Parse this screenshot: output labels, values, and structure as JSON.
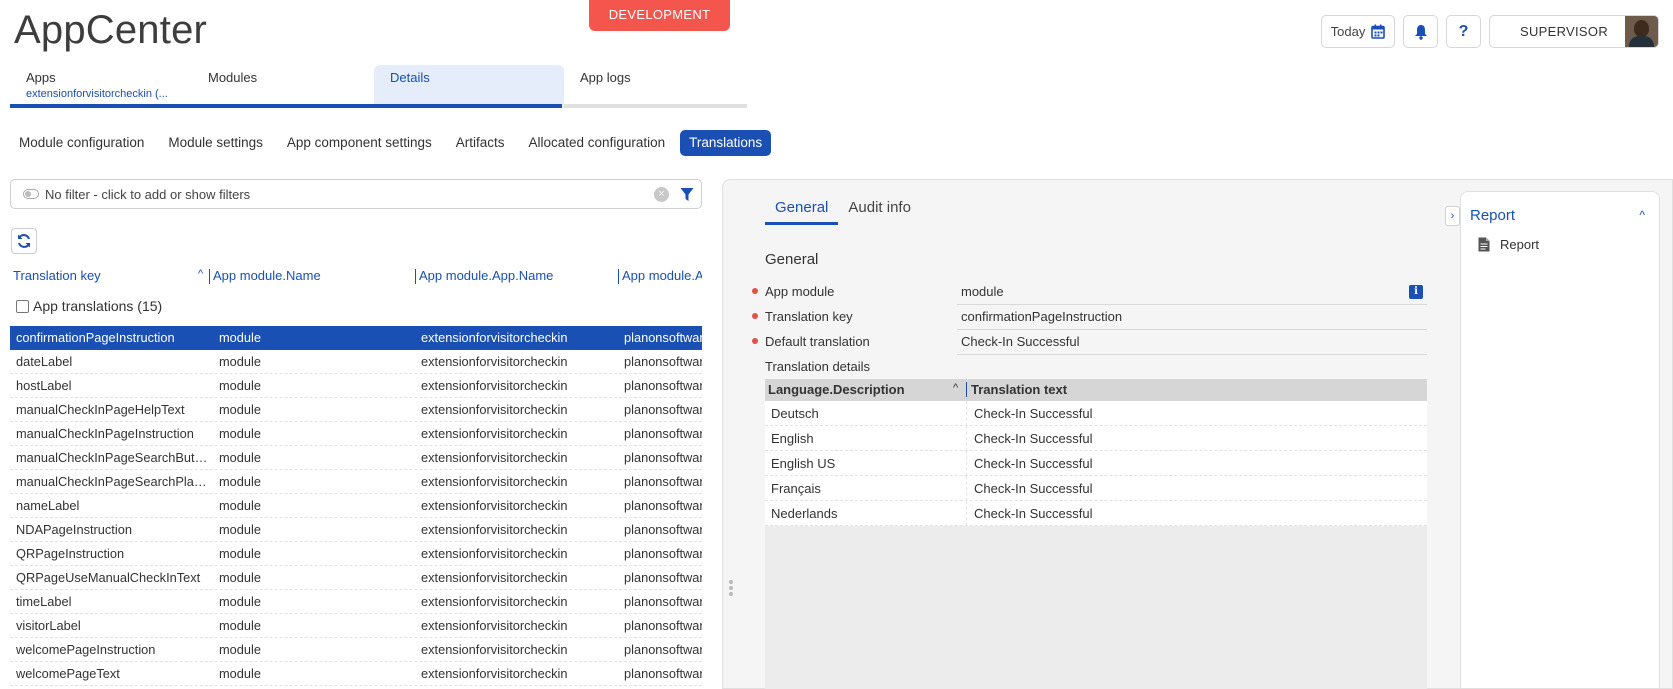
{
  "app": {
    "title": "AppCenter",
    "environment": "DEVELOPMENT"
  },
  "header": {
    "today_label": "Today",
    "help_label": "?",
    "user_name": "SUPERVISOR"
  },
  "main_tabs": [
    {
      "label": "Apps",
      "sub": "extensionforvisitorcheckin (..."
    },
    {
      "label": "Modules"
    },
    {
      "label": "Details"
    },
    {
      "label": "App logs"
    }
  ],
  "sub_tabs": [
    "Module configuration",
    "Module settings",
    "App component settings",
    "Artifacts",
    "Allocated configuration",
    "Translations"
  ],
  "filter": {
    "text": "No filter - click to add or show filters"
  },
  "grid": {
    "columns": [
      "Translation key",
      "App module.Name",
      "App module.App.Name",
      "App module.Ap"
    ],
    "group_label": "App translations (15)",
    "rows": [
      [
        "confirmationPageInstruction",
        "module",
        "extensionforvisitorcheckin",
        "planonsoftwar"
      ],
      [
        "dateLabel",
        "module",
        "extensionforvisitorcheckin",
        "planonsoftwar"
      ],
      [
        "hostLabel",
        "module",
        "extensionforvisitorcheckin",
        "planonsoftwar"
      ],
      [
        "manualCheckInPageHelpText",
        "module",
        "extensionforvisitorcheckin",
        "planonsoftwar"
      ],
      [
        "manualCheckInPageInstruction",
        "module",
        "extensionforvisitorcheckin",
        "planonsoftwar"
      ],
      [
        "manualCheckInPageSearchButto...",
        "module",
        "extensionforvisitorcheckin",
        "planonsoftwar"
      ],
      [
        "manualCheckInPageSearchPlace...",
        "module",
        "extensionforvisitorcheckin",
        "planonsoftwar"
      ],
      [
        "nameLabel",
        "module",
        "extensionforvisitorcheckin",
        "planonsoftwar"
      ],
      [
        "NDAPageInstruction",
        "module",
        "extensionforvisitorcheckin",
        "planonsoftwar"
      ],
      [
        "QRPageInstruction",
        "module",
        "extensionforvisitorcheckin",
        "planonsoftwar"
      ],
      [
        "QRPageUseManualCheckInText",
        "module",
        "extensionforvisitorcheckin",
        "planonsoftwar"
      ],
      [
        "timeLabel",
        "module",
        "extensionforvisitorcheckin",
        "planonsoftwar"
      ],
      [
        "visitorLabel",
        "module",
        "extensionforvisitorcheckin",
        "planonsoftwar"
      ],
      [
        "welcomePageInstruction",
        "module",
        "extensionforvisitorcheckin",
        "planonsoftwar"
      ],
      [
        "welcomePageText",
        "module",
        "extensionforvisitorcheckin",
        "planonsoftwar"
      ]
    ]
  },
  "detail": {
    "tabs": [
      "General",
      "Audit info"
    ],
    "section_title": "General",
    "fields": [
      {
        "label": "App module",
        "value": "module"
      },
      {
        "label": "Translation key",
        "value": "confirmationPageInstruction"
      },
      {
        "label": "Default translation",
        "value": "Check-In Successful"
      }
    ],
    "translation_details_label": "Translation details",
    "translation_columns": [
      "Language.Description",
      "Translation text"
    ],
    "translations": [
      [
        "Deutsch",
        "Check-In Successful"
      ],
      [
        "English",
        "Check-In Successful"
      ],
      [
        "English US",
        "Check-In Successful"
      ],
      [
        "Français",
        "Check-In Successful"
      ],
      [
        "Nederlands",
        "Check-In Successful"
      ]
    ]
  },
  "report": {
    "title": "Report",
    "item": "Report"
  },
  "colors": {
    "accent": "#1a4fb3",
    "environment": "#f4564d",
    "required": "#e05147"
  }
}
